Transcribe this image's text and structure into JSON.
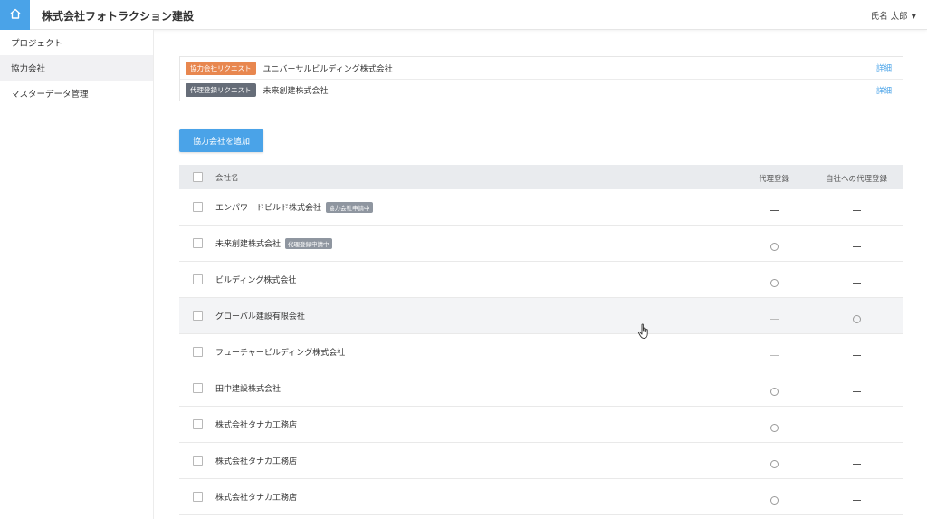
{
  "header": {
    "app_title": "株式会社フォトラクション建設",
    "user_name": "氏名 太郎",
    "user_caret": "▼",
    "home_icon": "home-icon"
  },
  "sidebar": {
    "items": [
      {
        "label": "プロジェクト",
        "active": false
      },
      {
        "label": "協力会社",
        "active": true
      },
      {
        "label": "マスターデータ管理",
        "active": false
      }
    ]
  },
  "notices": [
    {
      "tag": "協力会社リクエスト",
      "tag_color": "#e8874f",
      "text": "ユニバーサルビルディング株式会社",
      "link": "詳細"
    },
    {
      "tag": "代理登録リクエスト",
      "tag_color": "#666d78",
      "text": "未来創建株式会社",
      "link": "詳細"
    }
  ],
  "add_button": {
    "label": "協力会社を追加"
  },
  "table": {
    "headers": {
      "name": "会社名",
      "proxy": "代理登録",
      "self_proxy": "自社への代理登録"
    },
    "rows": [
      {
        "name": "エンパワードビルド株式会社",
        "badge": "協力会社申請中",
        "proxy": "dash",
        "self_proxy": "dash"
      },
      {
        "name": "未来創建株式会社",
        "badge": "代理登録申請中",
        "proxy": "circle",
        "self_proxy": "dash"
      },
      {
        "name": "ビルディング株式会社",
        "badge": "",
        "proxy": "circle",
        "self_proxy": "dash"
      },
      {
        "name": "グローバル建設有限会社",
        "badge": "",
        "proxy": "dash-light",
        "self_proxy": "circle"
      },
      {
        "name": "フューチャービルディング株式会社",
        "badge": "",
        "proxy": "dash-light",
        "self_proxy": "dash"
      },
      {
        "name": "田中建設株式会社",
        "badge": "",
        "proxy": "circle",
        "self_proxy": "dash"
      },
      {
        "name": "株式会社タナカ工務店",
        "badge": "",
        "proxy": "circle",
        "self_proxy": "dash"
      },
      {
        "name": "株式会社タナカ工務店",
        "badge": "",
        "proxy": "circle",
        "self_proxy": "dash"
      },
      {
        "name": "株式会社タナカ工務店",
        "badge": "",
        "proxy": "circle",
        "self_proxy": "dash"
      }
    ]
  },
  "colors": {
    "accent": "#4aa3e8",
    "request_orange": "#e8874f",
    "request_dark": "#666d78"
  }
}
